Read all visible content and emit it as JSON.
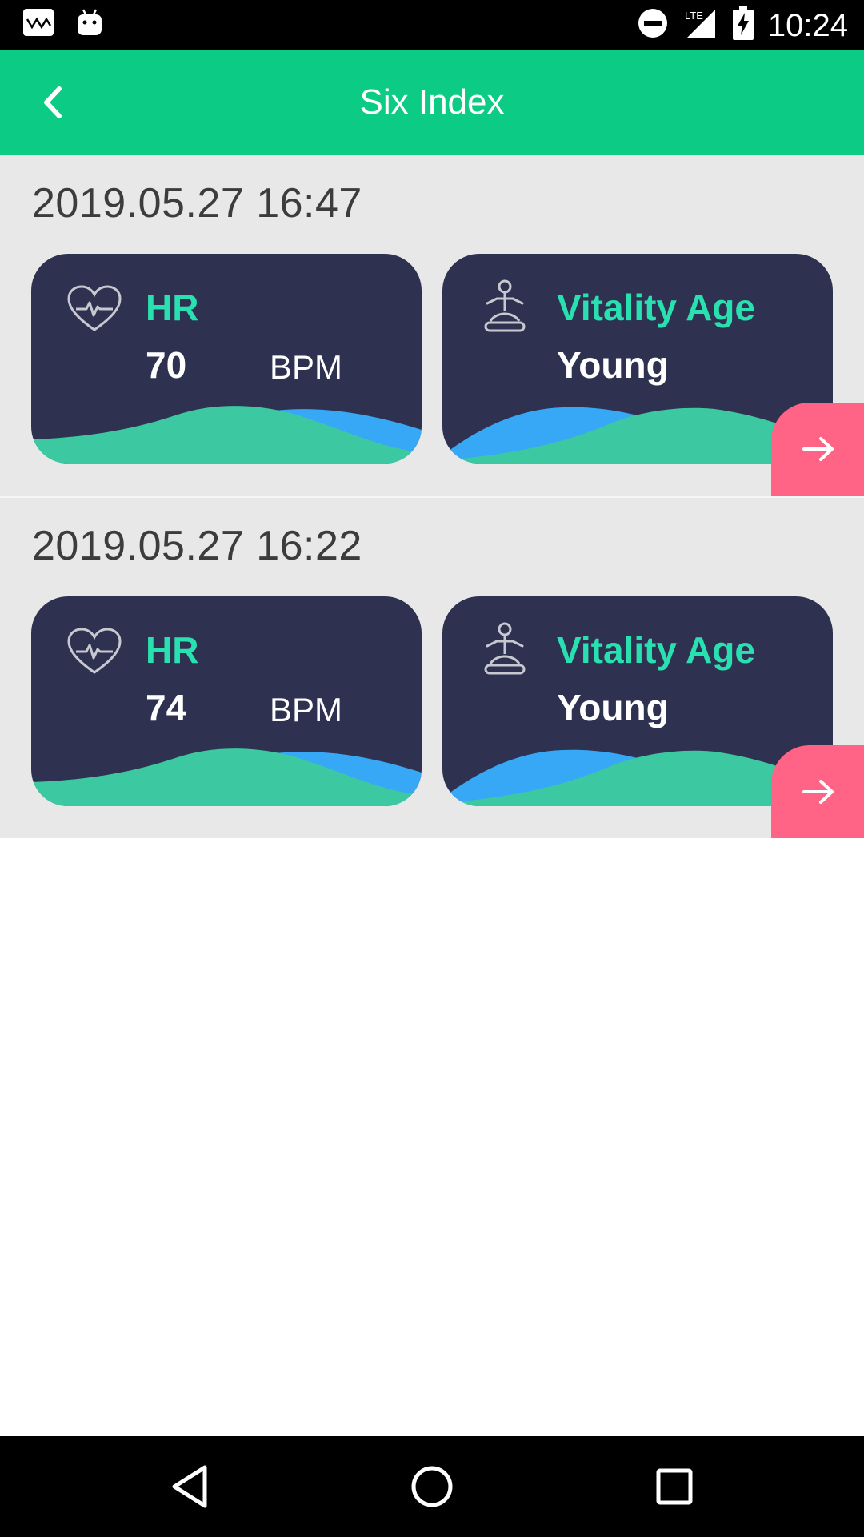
{
  "status_bar": {
    "time": "10:24",
    "network": "LTE",
    "icons": [
      "wave-notification-icon",
      "android-icon",
      "do-not-disturb-icon",
      "signal-icon",
      "battery-charging-icon"
    ]
  },
  "app_bar": {
    "title": "Six Index",
    "back_icon": "chevron-left-icon"
  },
  "records": [
    {
      "date": "2019.05.27 16:47",
      "hr": {
        "label": "HR",
        "value": "70",
        "unit": "BPM"
      },
      "vitality": {
        "label": "Vitality Age",
        "value": "Young"
      }
    },
    {
      "date": "2019.05.27 16:22",
      "hr": {
        "label": "HR",
        "value": "74",
        "unit": "BPM"
      },
      "vitality": {
        "label": "Vitality Age",
        "value": "Young"
      }
    }
  ],
  "colors": {
    "app_bar": "#0ccb84",
    "card_background": "#2e3150",
    "label_accent": "#29e0b0",
    "go_button": "#ff6386",
    "wave_green": "#3cc8a0",
    "wave_blue": "#36a8f5"
  },
  "nav_bar": {
    "icons": [
      "back-triangle-icon",
      "home-circle-icon",
      "recents-square-icon"
    ]
  }
}
